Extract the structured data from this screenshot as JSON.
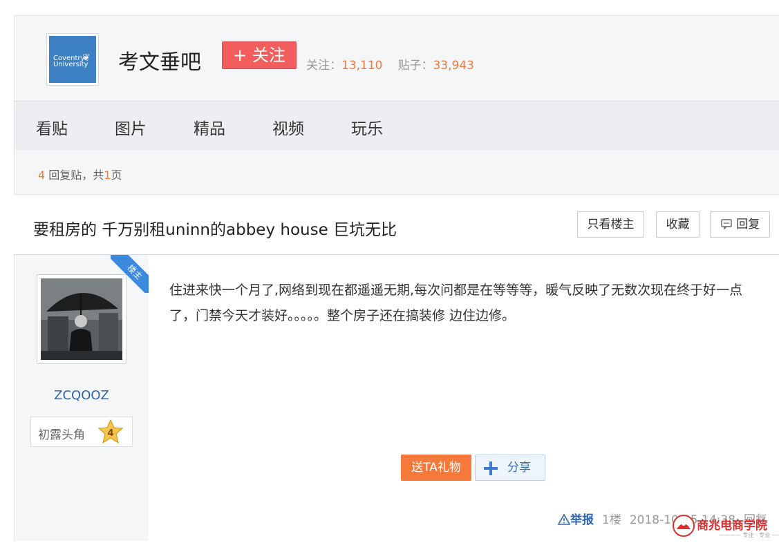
{
  "forum": {
    "logo_line1": "Coventry",
    "logo_line2": "University",
    "name": "考文垂吧",
    "follow_label": "+ 关注",
    "follow_count_label": "关注：",
    "follow_count": "13,110",
    "post_count_label": "贴子：",
    "post_count": "33,943"
  },
  "tabs": [
    "看贴",
    "图片",
    "精品",
    "视频",
    "玩乐"
  ],
  "reply_summary": {
    "count": "4",
    "text_mid": " 回复贴，共",
    "pages": "1",
    "text_end": "页"
  },
  "thread": {
    "title": "要租房的 千万别租uninn的abbey house 巨坑无比",
    "buttons": {
      "only_op": "只看楼主",
      "favorite": "收藏",
      "reply": "回复"
    }
  },
  "post": {
    "op_badge": "楼主",
    "author": "ZCQOOZ",
    "level_name": "初露头角",
    "level": "4",
    "content": "住进来快一个月了,网络到现在都遥遥无期,每次问都是在等等等，暖气反映了无数次现在终于好一点了，门禁今天才装好。。。。。整个房子还在搞装修 边住边修。",
    "gift_label": "送TA礼物",
    "share_label": "分享",
    "report_label": "举报",
    "floor": "1楼",
    "time": "2018-10-05 14:38",
    "reply_label": "回复"
  },
  "watermark": {
    "text": "商兆电商学院",
    "sub": "———— 专注 · 专业 ————"
  },
  "colors": {
    "accent_orange": "#f07a3c",
    "follow_red": "#f25e5e",
    "link_blue": "#2d64b3",
    "badge_blue": "#3c8ae0"
  }
}
